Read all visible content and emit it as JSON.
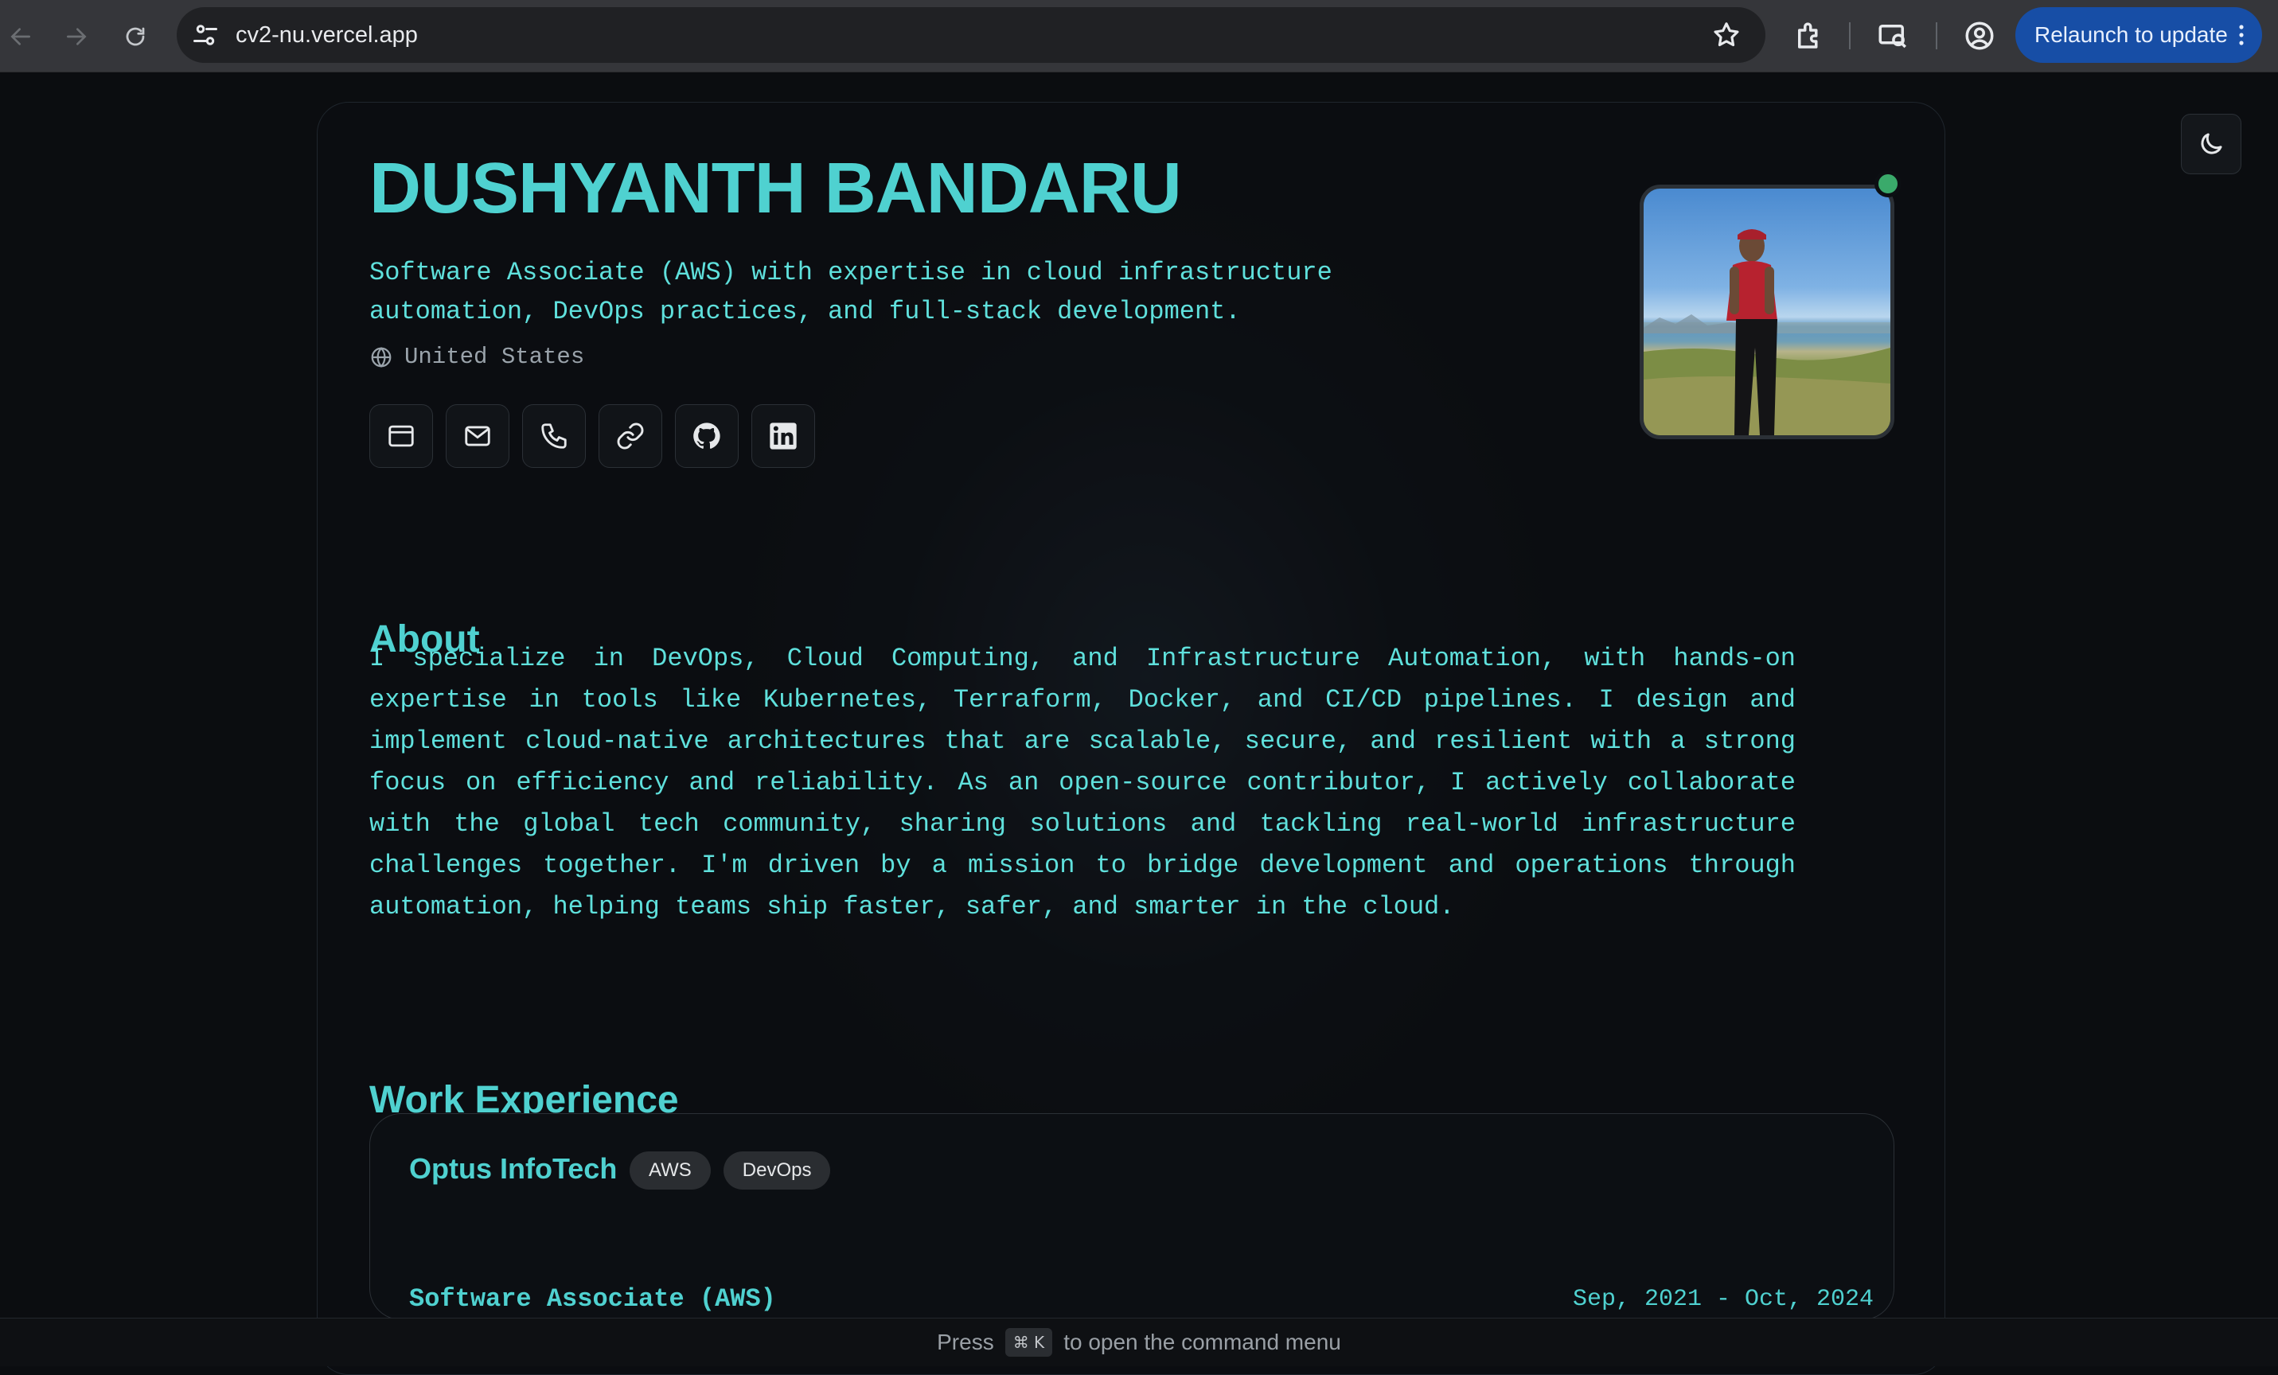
{
  "browser": {
    "url": "cv2-nu.vercel.app",
    "relaunch_label": "Relaunch to update"
  },
  "profile": {
    "name": "DUSHYANTH BANDARU",
    "tagline": "Software Associate (AWS) with expertise in cloud infrastructure automation, DevOps practices, and full-stack development.",
    "location": "United States",
    "contacts": [
      {
        "icon": "browser-window-icon"
      },
      {
        "icon": "mail-icon"
      },
      {
        "icon": "phone-icon"
      },
      {
        "icon": "link-icon"
      },
      {
        "icon": "github-icon"
      },
      {
        "icon": "linkedin-icon"
      }
    ],
    "status_color": "#3aaa6b"
  },
  "about": {
    "title": "About",
    "text": "I specialize in DevOps, Cloud Computing, and Infrastructure Automation, with hands-on expertise in tools like Kubernetes, Terraform, Docker, and CI/CD pipelines. I design and implement cloud-native architectures that are scalable, secure, and resilient with a strong focus on efficiency and reliability. As an open-source contributor, I actively collaborate with the global tech community, sharing solutions and tackling real-world infrastructure challenges together. I'm driven by a mission to bridge development and operations through automation, helping teams ship faster, safer, and smarter in the cloud."
  },
  "work": {
    "title": "Work Experience",
    "jobs": [
      {
        "company": "Optus InfoTech",
        "badges": [
          "AWS",
          "DevOps"
        ],
        "role": "Software Associate (AWS)",
        "dates": "Sep, 2021 - Oct, 2024"
      }
    ]
  },
  "command_bar": {
    "prefix": "Press",
    "shortcut": "⌘ K",
    "suffix": "to open the command menu"
  },
  "theme": {
    "accent": "#4fd1d0",
    "background": "#0b0d10"
  }
}
